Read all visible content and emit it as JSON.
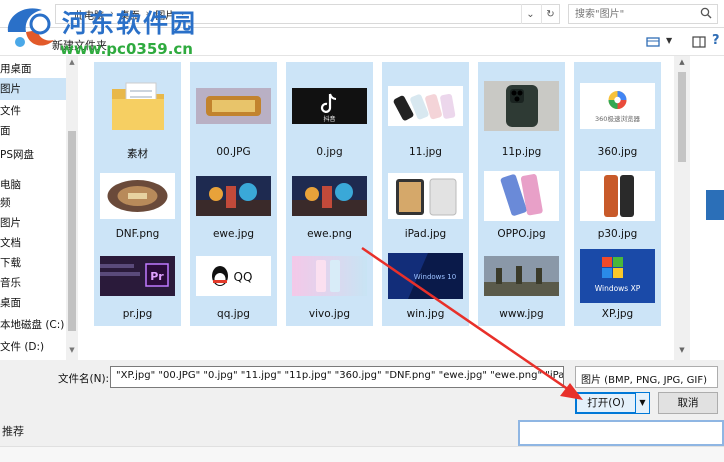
{
  "address": {
    "crumbs": [
      "此电脑",
      "桌面",
      "图片"
    ],
    "refresh_icon": "refresh-icon",
    "dropdown_icon": "chevron-down-icon"
  },
  "search": {
    "placeholder": "搜索\"图片\""
  },
  "watermark": {
    "cn": "河东软件园",
    "url": "www.pc0359.cn"
  },
  "toolbar": {
    "new_folder": "新建文件夹"
  },
  "nav": {
    "items": [
      {
        "label": "用桌面",
        "selected": false
      },
      {
        "label": "图片",
        "selected": true
      },
      {
        "label": "文件",
        "selected": false
      },
      {
        "label": "面",
        "selected": false
      },
      {
        "label": "PS网盘",
        "selected": false
      },
      {
        "label": "电脑",
        "selected": false
      },
      {
        "label": "频",
        "selected": false
      },
      {
        "label": "图片",
        "selected": false
      },
      {
        "label": "文档",
        "selected": false
      },
      {
        "label": "下载",
        "selected": false
      },
      {
        "label": "音乐",
        "selected": false
      },
      {
        "label": "桌面",
        "selected": false
      },
      {
        "label": "本地磁盘 (C:)",
        "selected": false
      },
      {
        "label": "文件 (D:)",
        "selected": false
      }
    ]
  },
  "files": [
    {
      "name": "素材",
      "kind": "folder",
      "selected": true
    },
    {
      "name": "00.JPG",
      "kind": "game",
      "selected": true
    },
    {
      "name": "0.jpg",
      "kind": "tiktok",
      "selected": true
    },
    {
      "name": "11.jpg",
      "kind": "phones",
      "selected": true
    },
    {
      "name": "11p.jpg",
      "kind": "phone-dark",
      "selected": true
    },
    {
      "name": "360.jpg",
      "kind": "browser360",
      "selected": true
    },
    {
      "name": "DNF.png",
      "kind": "dnf",
      "selected": true
    },
    {
      "name": "ewe.jpg",
      "kind": "action",
      "selected": true
    },
    {
      "name": "ewe.png",
      "kind": "action",
      "selected": true
    },
    {
      "name": "iPad.jpg",
      "kind": "ipad",
      "selected": true
    },
    {
      "name": "OPPO.jpg",
      "kind": "oppo",
      "selected": true
    },
    {
      "name": "p30.jpg",
      "kind": "p30",
      "selected": true
    },
    {
      "name": "pr.jpg",
      "kind": "premiere",
      "selected": true
    },
    {
      "name": "qq.jpg",
      "kind": "qq",
      "selected": true
    },
    {
      "name": "vivo.jpg",
      "kind": "vivo",
      "selected": true
    },
    {
      "name": "win.jpg",
      "kind": "windows10",
      "selected": true
    },
    {
      "name": "www.jpg",
      "kind": "pubg",
      "selected": true
    },
    {
      "name": "XP.jpg",
      "kind": "winxp",
      "selected": true
    },
    {
      "name": "",
      "kind": "iphone-partial",
      "selected": false
    }
  ],
  "thumb_text": {
    "tiktok": "抖音",
    "browser360": "360极速浏览器",
    "qq": "QQ",
    "windows10": "Windows 10",
    "winxp": "Windows XP",
    "premiere": "Pr"
  },
  "bottom": {
    "filename_label": "文件名(N):",
    "filename_value": "\"XP.jpg\" \"00.JPG\" \"0.jpg\" \"11.jpg\" \"11p.jpg\" \"360.jpg\" \"DNF.png\" \"ewe.jpg\" \"ewe.png\" \"iPad.jpg\"",
    "filetype": "图片 (BMP, PNG, JPG, GIF)",
    "open_label": "打开(O)",
    "cancel_label": "取消"
  },
  "behind": {
    "text": "推荐"
  },
  "colors": {
    "selection": "#cce4f7",
    "accent": "#0078d7",
    "arrow": "#e8302a",
    "watermark_blue": "#2a70c8",
    "watermark_green": "#2eaa3e"
  }
}
